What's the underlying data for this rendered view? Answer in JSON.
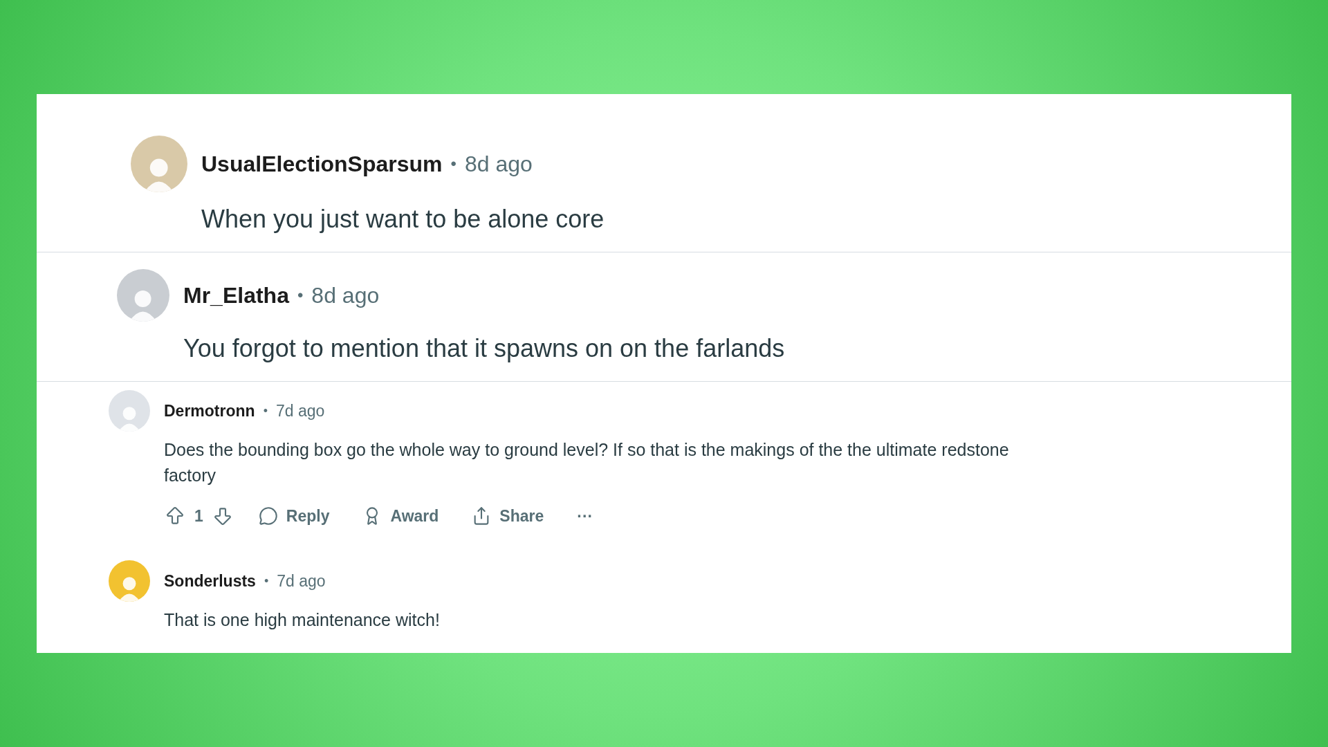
{
  "comments": [
    {
      "kind": "large",
      "author": "UsualElectionSparsum",
      "separator": "•",
      "time": "8d ago",
      "body": "When you just want to be alone core",
      "color": "#d9c9a8"
    },
    {
      "kind": "large",
      "author": "Mr_Elatha",
      "separator": "•",
      "time": "8d ago",
      "body": "You forgot to mention that it spawns on on the farlands",
      "color": "#c9cdd2"
    },
    {
      "kind": "small",
      "author": "Dermotronn",
      "separator": "•",
      "time": "7d ago",
      "body": "Does the bounding box go the whole way to ground level? If so that is the makings of the the ultimate redstone factory",
      "color": "#dfe3e8",
      "actions": {
        "votes": "1",
        "reply": "Reply",
        "award": "Award",
        "share": "Share",
        "more": "···"
      }
    },
    {
      "kind": "small",
      "author": "Sonderlusts",
      "separator": "•",
      "time": "7d ago",
      "body": "That is one high maintenance witch!",
      "color": "#f2c230"
    }
  ]
}
